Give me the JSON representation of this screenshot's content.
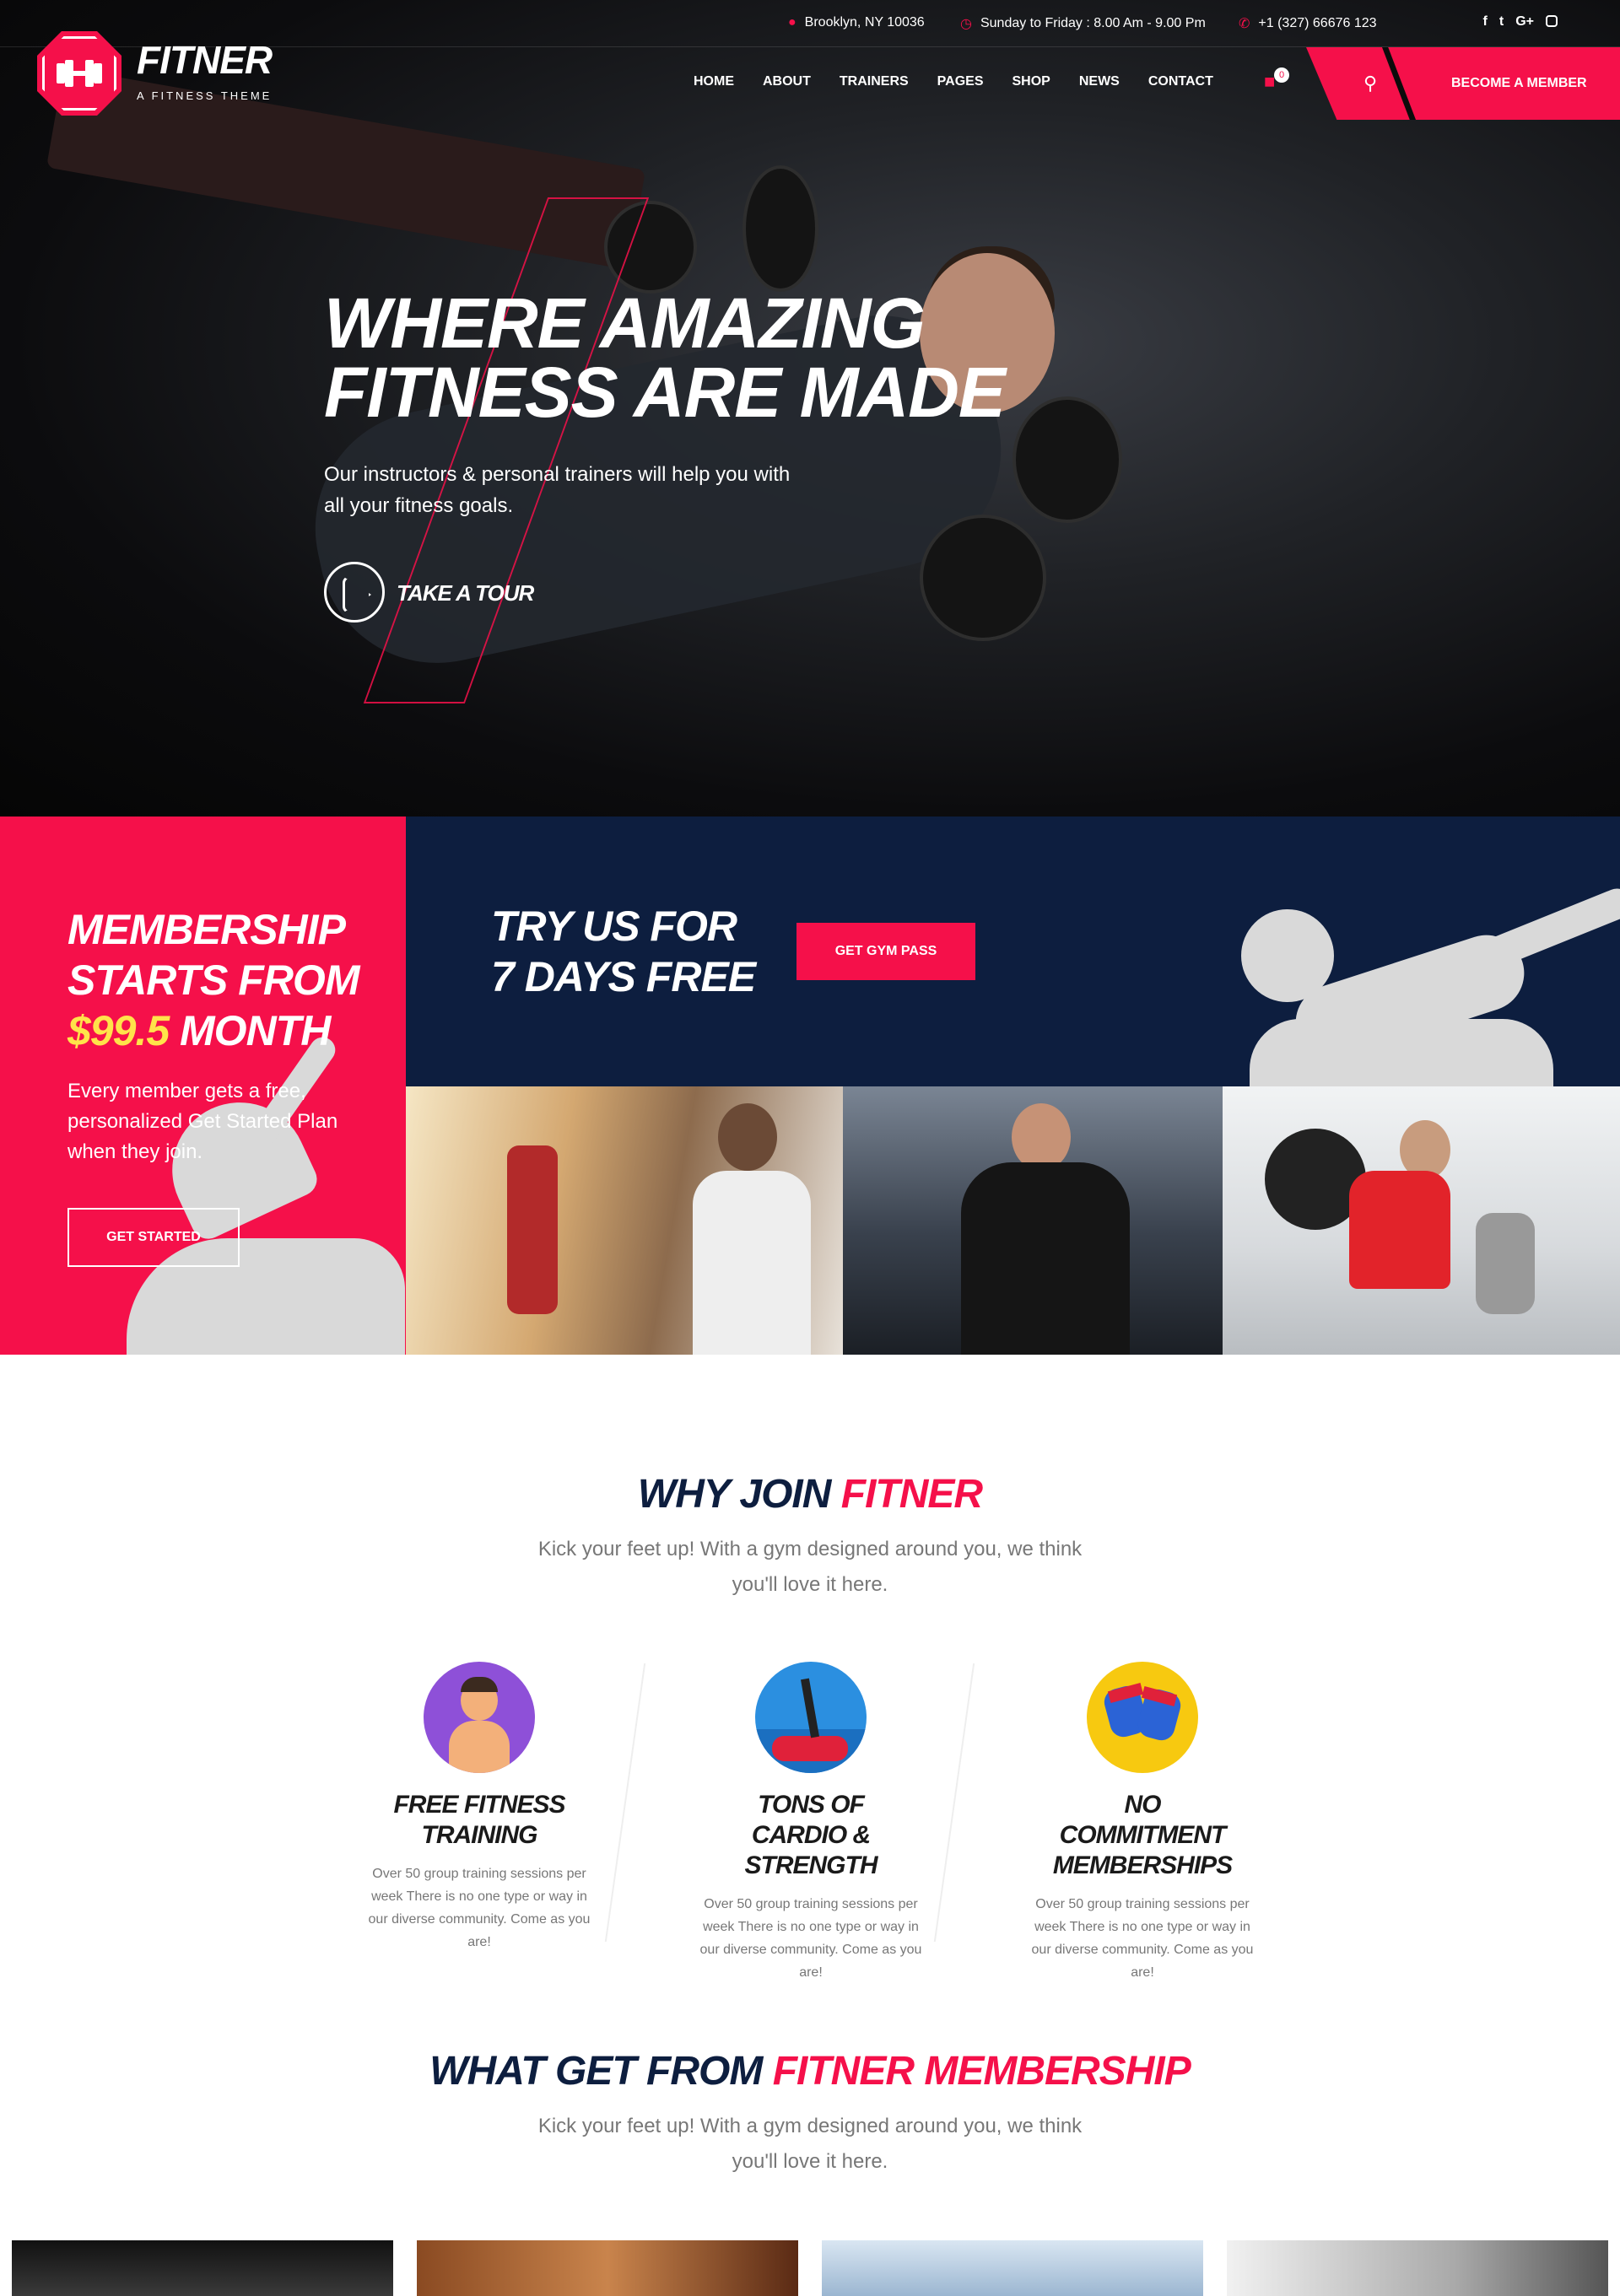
{
  "brand": {
    "name": "FITNER",
    "tagline": "A FITNESS THEME"
  },
  "topbar": {
    "location": "Brooklyn, NY 10036",
    "hours": "Sunday to Friday : 8.00 Am - 9.00 Pm",
    "phone": "+1 (327) 66676 123",
    "social": [
      "f",
      "t",
      "G+",
      "ig"
    ]
  },
  "nav": {
    "items": [
      "HOME",
      "ABOUT",
      "TRAINERS",
      "PAGES",
      "SHOP",
      "NEWS",
      "CONTACT"
    ],
    "cart_count": "0",
    "cta": "BECOME A MEMBER"
  },
  "hero": {
    "title_line1": "WHERE AMAZING",
    "title_line2": "FITNESS ARE MADE",
    "subtitle": "Our instructors & personal trainers will help you with all your fitness goals.",
    "tour_label": "TAKE A TOUR"
  },
  "membership": {
    "line1": "MEMBERSHIP",
    "line2": "STARTS FROM",
    "price": "$99.5",
    "period": "MONTH",
    "text": "Every member gets a free, personalized Get Started Plan when they join.",
    "button": "GET STARTED"
  },
  "trial": {
    "line1": "TRY US FOR",
    "line2": "7 DAYS FREE",
    "button": "GET GYM PASS"
  },
  "why": {
    "title_a": "WHY JOIN",
    "title_b": "FITNER",
    "subtitle": "Kick your feet up! With a gym designed around you, we think you'll love it here.",
    "features": [
      {
        "title": "FREE FITNESS TRAINING",
        "text": "Over 50 group training sessions per week There is no one type or way in our diverse community. Come as you are!",
        "icon": "trainer-icon"
      },
      {
        "title": "TONS OF CARDIO & STRENGTH",
        "text": "Over 50 group training sessions per week There is no one type or way in our diverse community. Come as you are!",
        "icon": "cardio-machine-icon"
      },
      {
        "title": "NO COMMITMENT MEMBERSHIPS",
        "text": "Over 50 group training sessions per week There is no one type or way in our diverse community. Come as you are!",
        "icon": "boxing-gloves-icon"
      }
    ]
  },
  "membership_benefits": {
    "title_a": "WHAT GET FROM",
    "title_b": "FITNER MEMBERSHIP",
    "subtitle": "Kick your feet up! With a gym designed around you, we think you'll love it here."
  },
  "colors": {
    "accent": "#f5104a",
    "navy": "#0d1e3f",
    "price": "#ffe34a"
  }
}
